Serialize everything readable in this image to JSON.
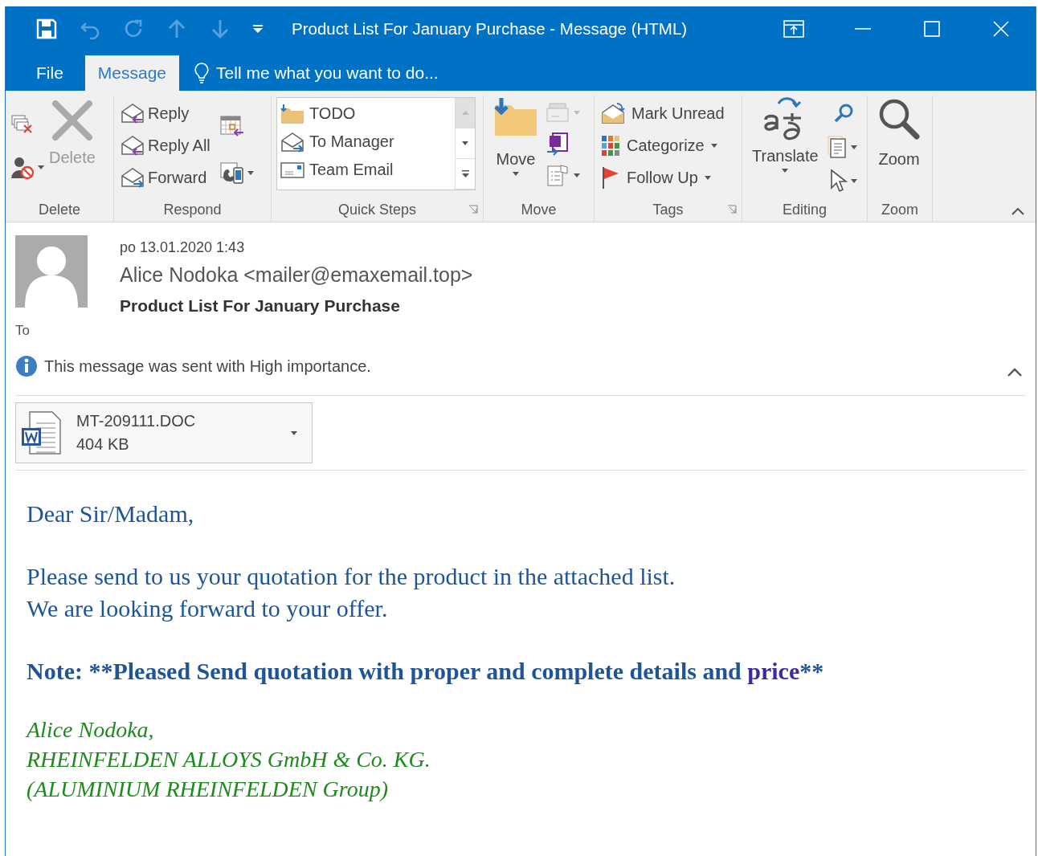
{
  "window": {
    "title": "Product List For January Purchase - Message (HTML)"
  },
  "ribbon_tabs": [
    {
      "label": "File",
      "selected": false
    },
    {
      "label": "Message",
      "selected": true
    }
  ],
  "tell_me": {
    "placeholder": "Tell me what you want to do..."
  },
  "ribbon": {
    "groups": [
      {
        "label": "Delete",
        "buttons": [
          {
            "label": "Delete",
            "disabled": true
          }
        ]
      },
      {
        "label": "Respond",
        "buttons": [
          {
            "label": "Reply"
          },
          {
            "label": "Reply All"
          },
          {
            "label": "Forward"
          }
        ]
      },
      {
        "label": "Quick Steps",
        "quick_steps": [
          {
            "label": "TODO"
          },
          {
            "label": "To Manager"
          },
          {
            "label": "Team Email"
          }
        ]
      },
      {
        "label": "Move",
        "buttons": [
          {
            "label": "Move"
          }
        ]
      },
      {
        "label": "Tags",
        "buttons": [
          {
            "label": "Mark Unread"
          },
          {
            "label": "Categorize"
          },
          {
            "label": "Follow Up"
          }
        ]
      },
      {
        "label": "Editing",
        "buttons": [
          {
            "label": "Translate"
          }
        ]
      },
      {
        "label": "Zoom",
        "buttons": [
          {
            "label": "Zoom"
          }
        ]
      }
    ]
  },
  "message": {
    "date": "po 13.01.2020 1:43",
    "sender": "Alice Nodoka <mailer@emaxemail.top>",
    "subject": "Product List For January Purchase",
    "to_label": "To",
    "info": "This message was sent with High importance.",
    "attachment": {
      "name": "MT-209111.DOC",
      "size": "404 KB"
    }
  },
  "body": {
    "greeting": "Dear Sir/Madam,",
    "paragraph": [
      "Please send to us your quotation for the product in the attached list.",
      "We are looking forward to your offer."
    ],
    "note": [
      {
        "kind": "normal",
        "text": "Note: **Pleased Send quotation with proper and complete details and "
      },
      {
        "kind": "highlight",
        "text": "price"
      },
      {
        "kind": "normal",
        "text": "**"
      }
    ],
    "signature": [
      "Alice Nodoka,",
      "RHEINFELDEN ALLOYS GmbH & Co. KG.",
      "(ALUMINIUM RHEINFELDEN Group)"
    ]
  }
}
